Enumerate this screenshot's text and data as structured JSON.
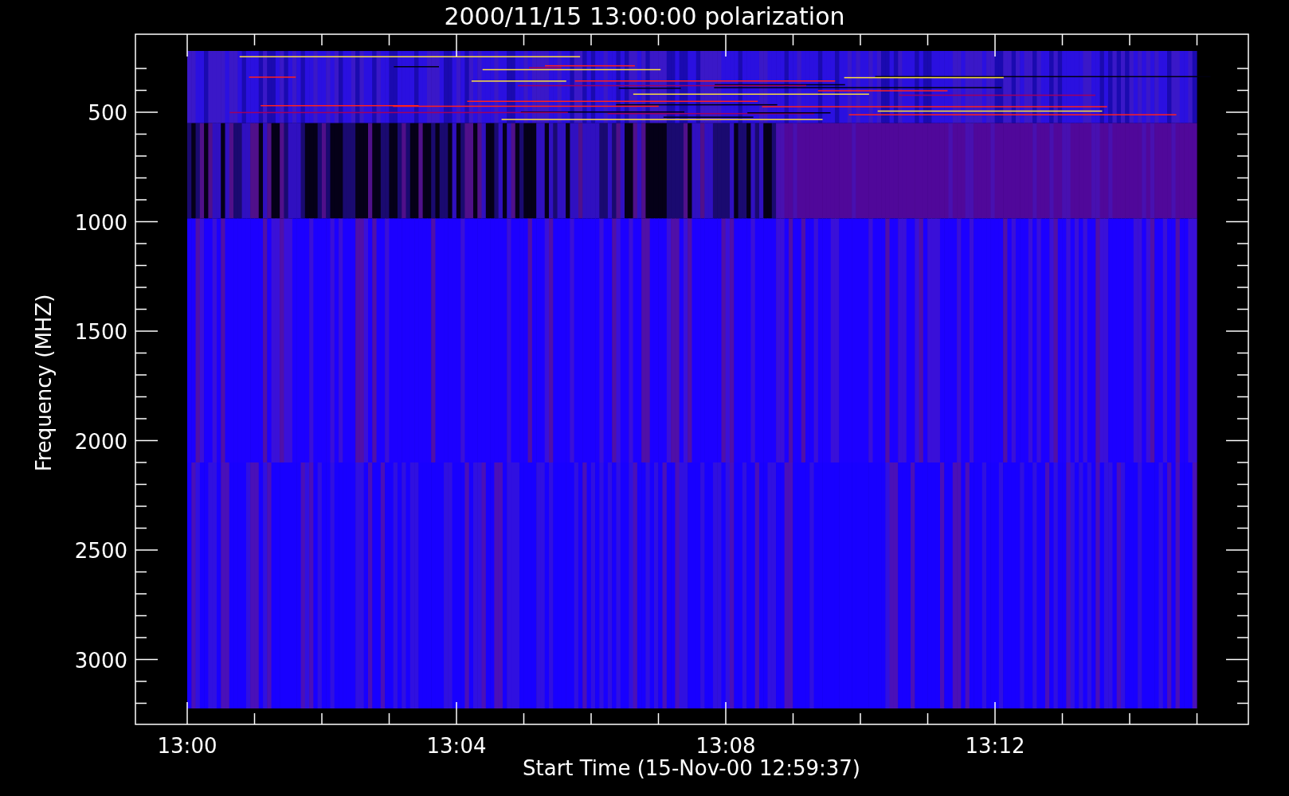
{
  "title": "2000/11/15 13:00:00 polarization",
  "y_axis": {
    "label": "Frequency (MHZ)",
    "ticks": [
      "500",
      "1000",
      "1500",
      "2000",
      "2500",
      "3000"
    ]
  },
  "x_axis": {
    "label": "Start Time (15-Nov-00 12:59:37)",
    "ticks": [
      "13:00",
      "13:04",
      "13:08",
      "13:12"
    ]
  }
}
